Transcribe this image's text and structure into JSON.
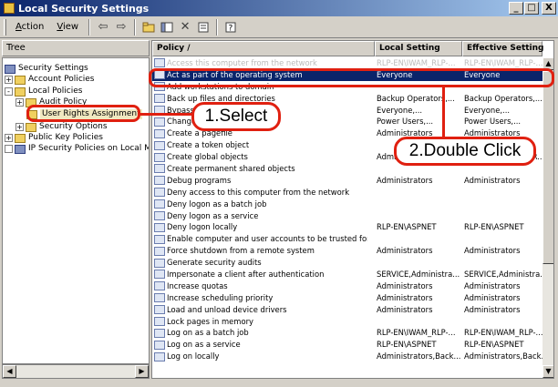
{
  "window": {
    "title": "Local Security Settings",
    "controls": [
      "_",
      "□",
      "X"
    ]
  },
  "menu": {
    "items": [
      {
        "hot": "A",
        "rest": "ction"
      },
      {
        "hot": "V",
        "rest": "iew"
      }
    ]
  },
  "toolbar": {
    "icons": [
      "back-arrow-icon",
      "forward-arrow-icon",
      "up-folder-icon",
      "show-tree-icon",
      "delete-icon",
      "properties-icon",
      "help-icon"
    ]
  },
  "tree": {
    "header": "Tree",
    "nodes": [
      {
        "label": "Security Settings",
        "expander": ""
      },
      {
        "label": "Account Policies",
        "expander": "+"
      },
      {
        "label": "Local Policies",
        "expander": "-"
      },
      {
        "label": "Audit Policy",
        "expander": "+"
      },
      {
        "label": "User Rights Assignment",
        "expander": ""
      },
      {
        "label": "Security Options",
        "expander": "+"
      },
      {
        "label": "Public Key Policies",
        "expander": "+"
      },
      {
        "label": "IP Security Policies on Local Ma",
        "expander": ""
      }
    ]
  },
  "list": {
    "columns": [
      "Policy",
      "Local Setting",
      "Effective Setting"
    ],
    "rows": [
      {
        "policy": "Access this computer from the network",
        "local": "RLP-EN\\IWAM_RLP-...",
        "effective": "RLP-EN\\IWAM_RLP-..."
      },
      {
        "policy": "Act as part of the operating system",
        "local": "Everyone",
        "effective": "Everyone"
      },
      {
        "policy": "Add workstations to domain",
        "local": "",
        "effective": ""
      },
      {
        "policy": "Back up files and directories",
        "local": "Backup Operators,...",
        "effective": "Backup Operators,..."
      },
      {
        "policy": "Bypass traverse checking",
        "local": "Everyone,...",
        "effective": "Everyone,..."
      },
      {
        "policy": "Change the system time",
        "local": "Power Users,...",
        "effective": "Power Users,..."
      },
      {
        "policy": "Create a pagefile",
        "local": "Administrators",
        "effective": "Administrators"
      },
      {
        "policy": "Create a token object",
        "local": "",
        "effective": ""
      },
      {
        "policy": "Create global objects",
        "local": "Administrators,SER...",
        "effective": "Administrators,SER..."
      },
      {
        "policy": "Create permanent shared objects",
        "local": "",
        "effective": ""
      },
      {
        "policy": "Debug programs",
        "local": "Administrators",
        "effective": "Administrators"
      },
      {
        "policy": "Deny access to this computer from the network",
        "local": "",
        "effective": ""
      },
      {
        "policy": "Deny logon as a batch job",
        "local": "",
        "effective": ""
      },
      {
        "policy": "Deny logon as a service",
        "local": "",
        "effective": ""
      },
      {
        "policy": "Deny logon locally",
        "local": "RLP-EN\\ASPNET",
        "effective": "RLP-EN\\ASPNET"
      },
      {
        "policy": "Enable computer and user accounts to be trusted for del...",
        "local": "",
        "effective": ""
      },
      {
        "policy": "Force shutdown from a remote system",
        "local": "Administrators",
        "effective": "Administrators"
      },
      {
        "policy": "Generate security audits",
        "local": "",
        "effective": ""
      },
      {
        "policy": "Impersonate a client after authentication",
        "local": "SERVICE,Administra...",
        "effective": "SERVICE,Administra..."
      },
      {
        "policy": "Increase quotas",
        "local": "Administrators",
        "effective": "Administrators"
      },
      {
        "policy": "Increase scheduling priority",
        "local": "Administrators",
        "effective": "Administrators"
      },
      {
        "policy": "Load and unload device drivers",
        "local": "Administrators",
        "effective": "Administrators"
      },
      {
        "policy": "Lock pages in memory",
        "local": "",
        "effective": ""
      },
      {
        "policy": "Log on as a batch job",
        "local": "RLP-EN\\IWAM_RLP-...",
        "effective": "RLP-EN\\IWAM_RLP-..."
      },
      {
        "policy": "Log on as a service",
        "local": "RLP-EN\\ASPNET",
        "effective": "RLP-EN\\ASPNET"
      },
      {
        "policy": "Log on locally",
        "local": "Administrators,Back...",
        "effective": "Administrators,Back..."
      }
    ]
  },
  "annotations": {
    "step1": "1.Select",
    "step2": "2.Double Click"
  },
  "colors": {
    "annotation": "#e02010",
    "selection": "#0a246a",
    "titlebar": "#0a246a"
  }
}
